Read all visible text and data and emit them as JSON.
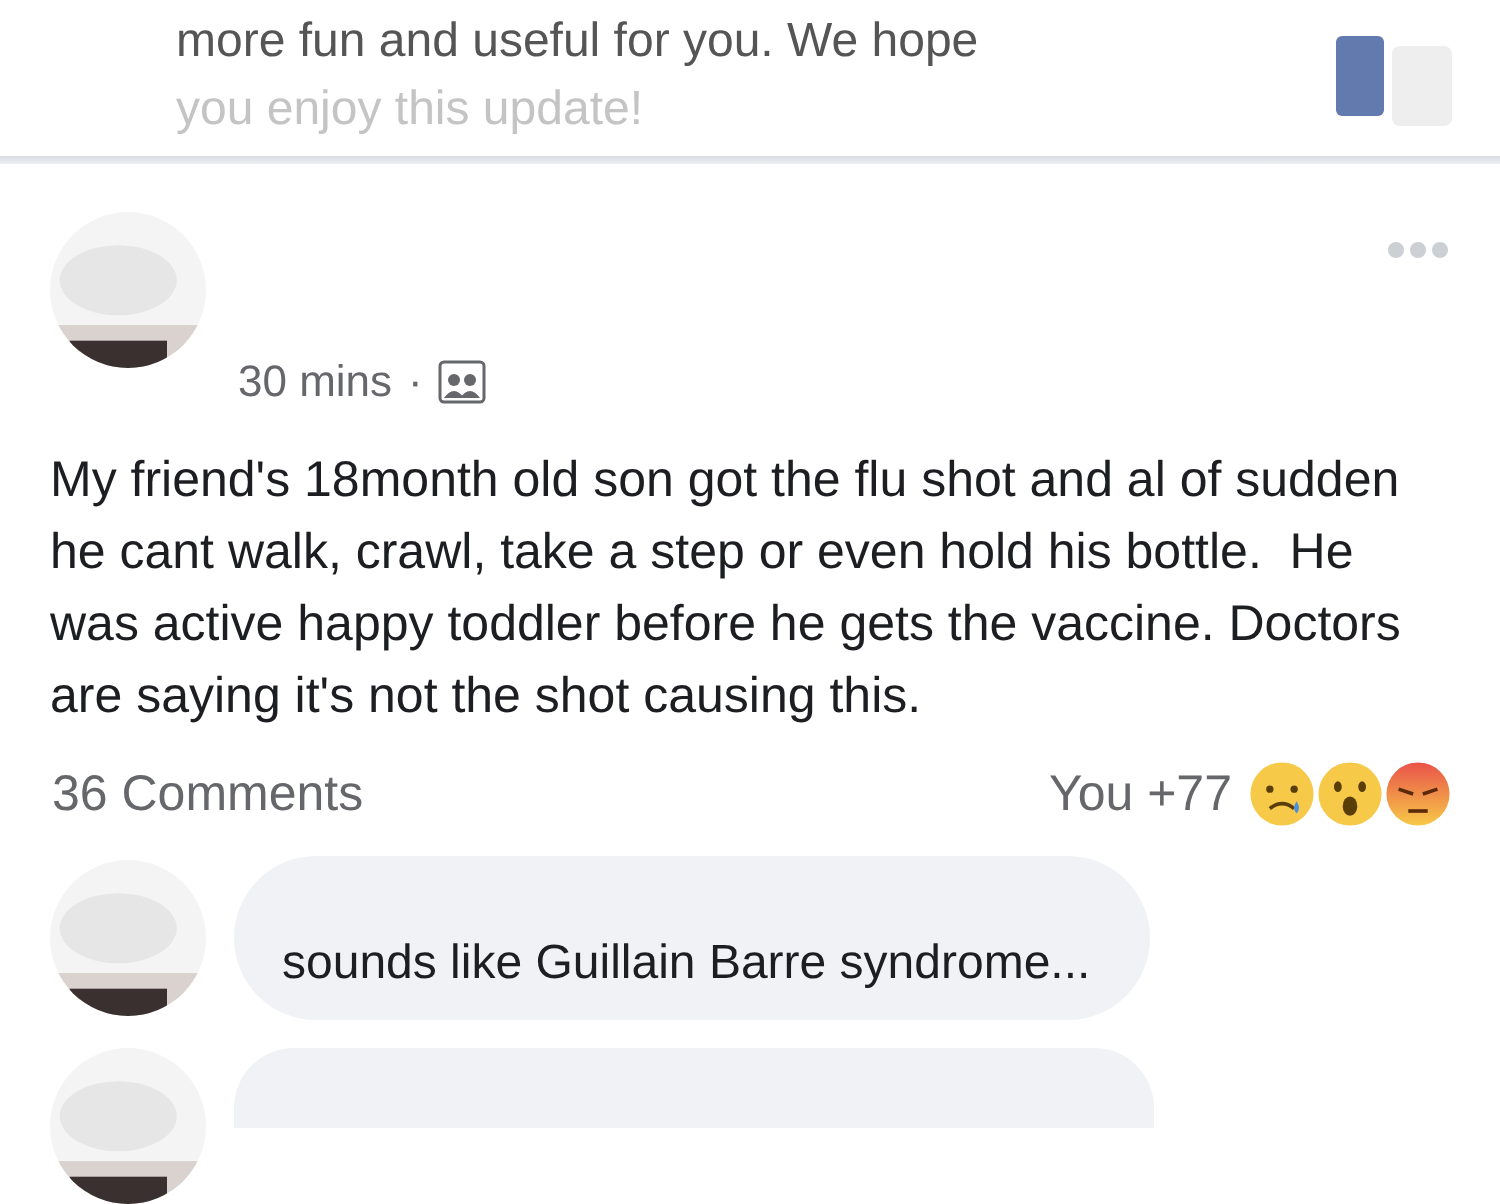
{
  "update_notice": {
    "lines": [
      "more fun and useful for you. We hope",
      "you enjoy this update!"
    ]
  },
  "post": {
    "time": "30 mins",
    "separator": "·",
    "body": "My friend's 18month old son got the flu shot and al of sudden he cant walk, crawl, take a step or even hold his bottle.  He was active happy toddler before he gets the vaccine. Doctors are saying it's not the shot causing this.",
    "comments_count": "36 Comments",
    "reactions_text": "You +77",
    "reactions": [
      {
        "kind": "sad"
      },
      {
        "kind": "wow"
      },
      {
        "kind": "angry"
      }
    ]
  },
  "comments": [
    {
      "text": "sounds like Guillain Barre syndrome..."
    }
  ]
}
